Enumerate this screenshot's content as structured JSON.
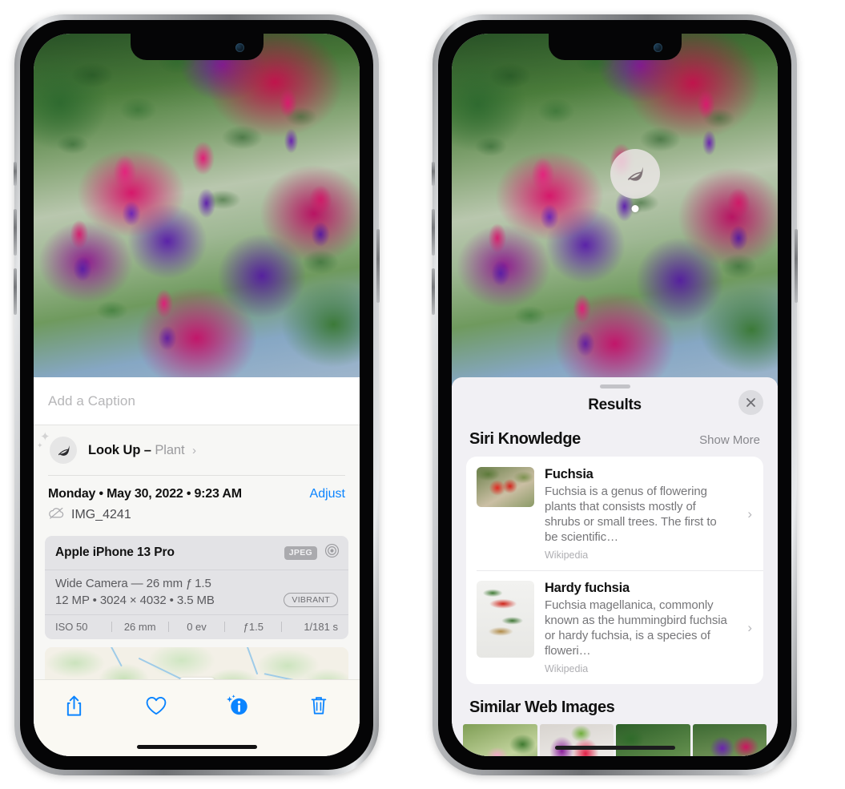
{
  "left_phone": {
    "caption": {
      "placeholder": "Add a Caption",
      "value": ""
    },
    "lookup": {
      "label": "Look Up –",
      "subject": "Plant",
      "chevron": "›",
      "icon": "leaf-icon"
    },
    "meta": {
      "date": "Monday • May 30, 2022 • 9:23 AM",
      "adjust_label": "Adjust",
      "filename": "IMG_4241",
      "cloud_icon": "icloud-slash-icon"
    },
    "exif": {
      "device": "Apple iPhone 13 Pro",
      "format_badge": "JPEG",
      "aperture_icon": "aperture-icon",
      "lens": "Wide Camera — 26 mm ƒ 1.5",
      "size_line": "12 MP • 3024 × 4032 • 3.5 MB",
      "vibrant_badge": "VIBRANT",
      "stats": [
        "ISO 50",
        "26 mm",
        "0 ev",
        "ƒ1.5",
        "1/181 s"
      ]
    },
    "toolbar": [
      {
        "name": "share-button",
        "icon": "share-icon"
      },
      {
        "name": "favorite-button",
        "icon": "heart-icon"
      },
      {
        "name": "info-button",
        "icon": "info-sparkle-icon"
      },
      {
        "name": "delete-button",
        "icon": "trash-icon"
      }
    ]
  },
  "right_phone": {
    "visual_lookup_badge": {
      "icon": "leaf-icon"
    },
    "sheet": {
      "title": "Results",
      "close_icon": "close-icon",
      "sections": [
        {
          "title": "Siri Knowledge",
          "action": "Show More"
        },
        {
          "title": "Similar Web Images",
          "action": ""
        }
      ]
    },
    "knowledge_cards": [
      {
        "title": "Fuchsia",
        "description": "Fuchsia is a genus of flowering plants that consists mostly of shrubs or small trees. The first to be scientific…",
        "source": "Wikipedia",
        "chevron": "›",
        "thumb": "fuchsia-thumbnail"
      },
      {
        "title": "Hardy fuchsia",
        "description": "Fuchsia magellanica, commonly known as the hummingbird fuchsia or hardy fuchsia, is a species of floweri…",
        "source": "Wikipedia",
        "chevron": "›",
        "thumb": "hardy-fuchsia-thumbnail"
      }
    ],
    "web_images": [
      {
        "name": "web-image-1"
      },
      {
        "name": "web-image-2"
      },
      {
        "name": "web-image-3"
      },
      {
        "name": "web-image-4"
      }
    ]
  },
  "colors": {
    "accent": "#0a84ff",
    "sheet_bg": "#f1f0f4",
    "card_bg": "#ffffff"
  }
}
